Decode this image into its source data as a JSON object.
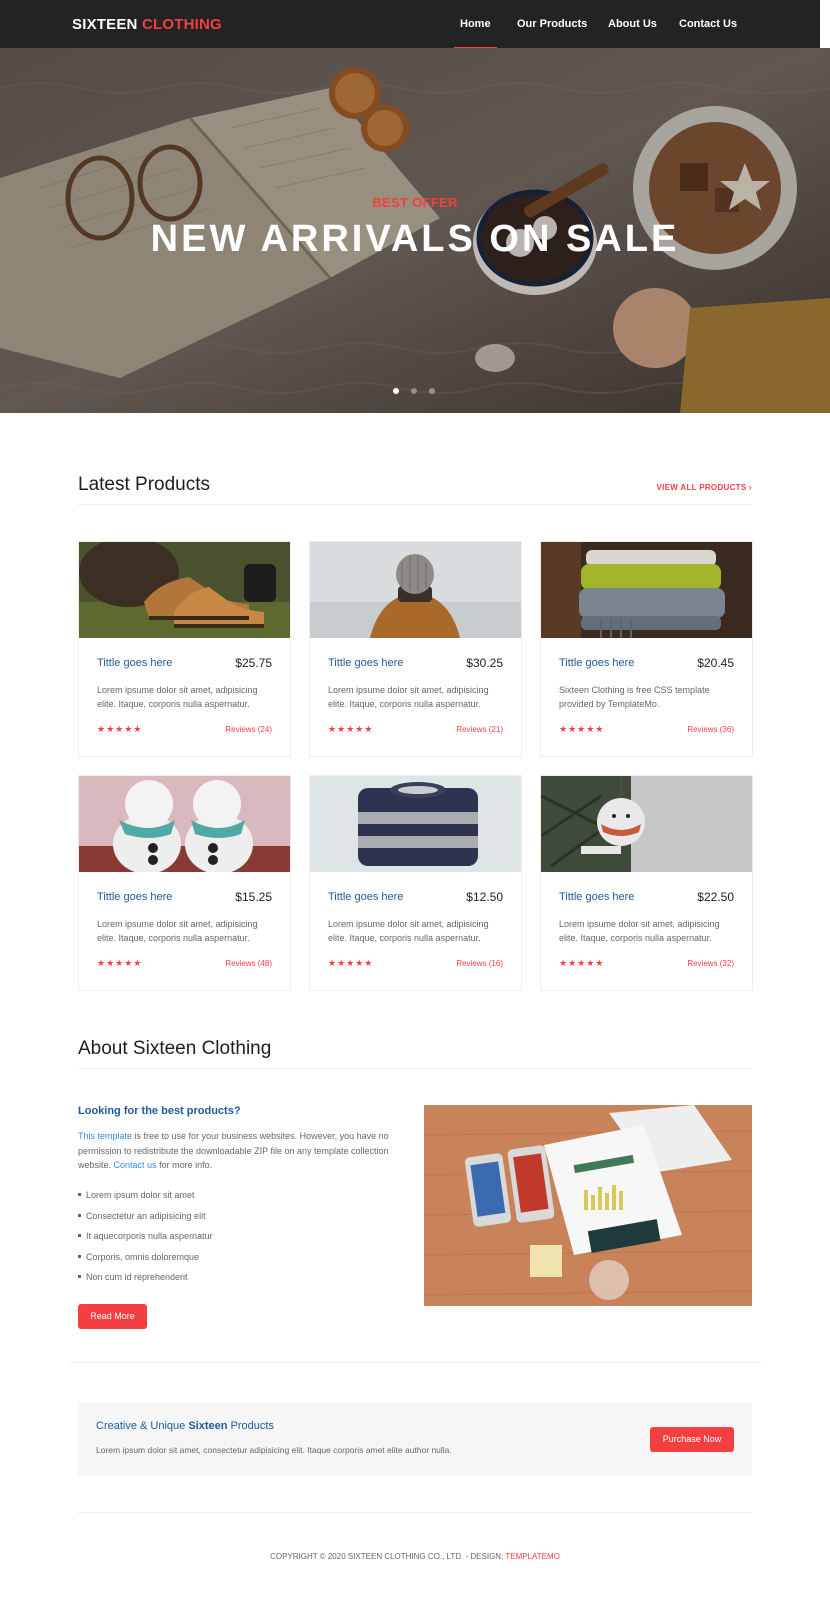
{
  "brand": {
    "name": "SIXTEEN",
    "accent": "CLOTHING"
  },
  "nav": {
    "items": [
      "Home",
      "Our Products",
      "About Us",
      "Contact Us"
    ],
    "active": "Home"
  },
  "hero": {
    "subtitle": "BEST OFFER",
    "title": "NEW ARRIVALS ON SALE",
    "slide_count": 3,
    "current_slide": 1
  },
  "latest": {
    "title": "Latest Products",
    "view_all": "VIEW ALL PRODUCTS ›",
    "products": [
      {
        "title": "Tittle goes here",
        "price": "$25.75",
        "desc": "Lorem ipsume dolor sit amet, adipisicing elite. Itaque, corporis nulla aspernatur.",
        "stars": "★★★★★",
        "reviews": "Reviews (24)",
        "image": "boots"
      },
      {
        "title": "Tittle goes here",
        "price": "$30.25",
        "desc": "Lorem ipsume dolor sit amet, adipisicing elite. Itaque, corporis nulla aspernatur.",
        "stars": "★★★★★",
        "reviews": "Reviews (21)",
        "image": "beanie-jacket"
      },
      {
        "title": "Tittle goes here",
        "price": "$20.45",
        "desc": "Sixteen Clothing is free CSS template provided by TemplateMo.",
        "stars": "★★★★★",
        "reviews": "Reviews (36)",
        "image": "scarves"
      },
      {
        "title": "Tittle goes here",
        "price": "$15.25",
        "desc": "Lorem ipsume dolor sit amet, adipisicing elite. Itaque, corporis nulla aspernatur.",
        "stars": "★★★★★",
        "reviews": "Reviews (48)",
        "image": "snowmen"
      },
      {
        "title": "Tittle goes here",
        "price": "$12.50",
        "desc": "Lorem ipsume dolor sit amet, adipisicing elite. Itaque, corporis nulla aspernatur.",
        "stars": "★★★★★",
        "reviews": "Reviews (16)",
        "image": "sweater"
      },
      {
        "title": "Tittle goes here",
        "price": "$22.50",
        "desc": "Lorem ipsume dolor sit amet, adipisicing elite. Itaque, corporis nulla aspernatur.",
        "stars": "★★★★★",
        "reviews": "Reviews (32)",
        "image": "ornament"
      }
    ]
  },
  "about": {
    "title": "About Sixteen Clothing",
    "subtitle": "Looking for the best products?",
    "text_link1": "This template",
    "text_part1": " is free to use for your business websites. However, you have no permission to redistribute the downloadable ZIP file on any template collection website. ",
    "text_link2": "Contact us",
    "text_part2": " for more info.",
    "list": [
      "Lorem ipsum dolor sit amet",
      "Consectetur an adipisicing elit",
      "It aquecorporis nulla aspernatur",
      "Corporis, omnis doloremque",
      "Non cum id reprehenderit"
    ],
    "button": "Read More"
  },
  "callout": {
    "title_part1": "Creative & Unique ",
    "title_bold": "Sixteen",
    "title_part2": " Products",
    "desc": "Lorem ipsum dolor sit amet, consectetur adipisicing elit. Itaque corporis amet elite author nulla.",
    "button": "Purchase Now"
  },
  "footer": {
    "text": "COPYRIGHT © 2020 SIXTEEN CLOTHING CO., LTD. - DESIGN: ",
    "link": "TEMPLATEMO"
  },
  "colors": {
    "accent": "#f33f3f",
    "link_blue": "#1e5a9a",
    "nav_bg": "#232323"
  }
}
